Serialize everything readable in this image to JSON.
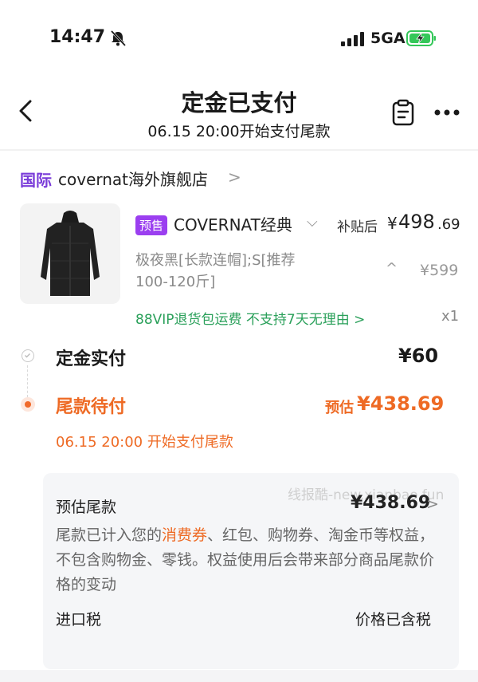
{
  "status_bar": {
    "time": "14:47",
    "network": "5GA",
    "icons": [
      "bell-muted-icon",
      "signal-icon",
      "battery-charging-icon"
    ]
  },
  "header": {
    "title": "定金已支付",
    "subtitle": "06.15 20:00开始支付尾款",
    "icons": [
      "back-arrow-icon",
      "clipboard-icon",
      "more-icon"
    ]
  },
  "store": {
    "tag": "国际",
    "name": "covernat海外旗舰店",
    "arrow": ">"
  },
  "product": {
    "badge": "预售",
    "title": "COVERNAT经典",
    "chevron": "⌵",
    "subsidy_label": "补贴后",
    "price_currency": "¥",
    "price_int": "498",
    "price_dec": ".69",
    "spec": "极夜黑[长款连帽];S[推荐100-120斤]",
    "spec_caret": "^",
    "original_price": "¥599",
    "service_tags": "88VIP退货包运费  不支持7天无理由 >",
    "quantity": "x1"
  },
  "payment": {
    "deposit_label": "定金实付",
    "deposit_amount": "¥60",
    "balance_label": "尾款待付",
    "balance_est_label": "预估",
    "balance_amount": "¥438.69",
    "balance_start": "06.15 20:00 开始支付尾款"
  },
  "info_box": {
    "watermark": "线报酷-new.xianbao.fun",
    "title": "预估尾款",
    "amount": "¥438.69",
    "arrow": ">",
    "desc_pre": "尾款已计入您的",
    "desc_hl": "消费券",
    "desc_post": "、红包、购物券、淘金币等权益，不包含购物金、零钱。权益使用后会带来部分商品尾款价格的变动",
    "tax_label": "进口税",
    "tax_value": "价格已含税"
  },
  "colors": {
    "accent_orange": "#ee6a24",
    "presale_purple": "#9b3ff0",
    "store_purple": "#7a3cd9",
    "service_green": "#2aa05a"
  }
}
